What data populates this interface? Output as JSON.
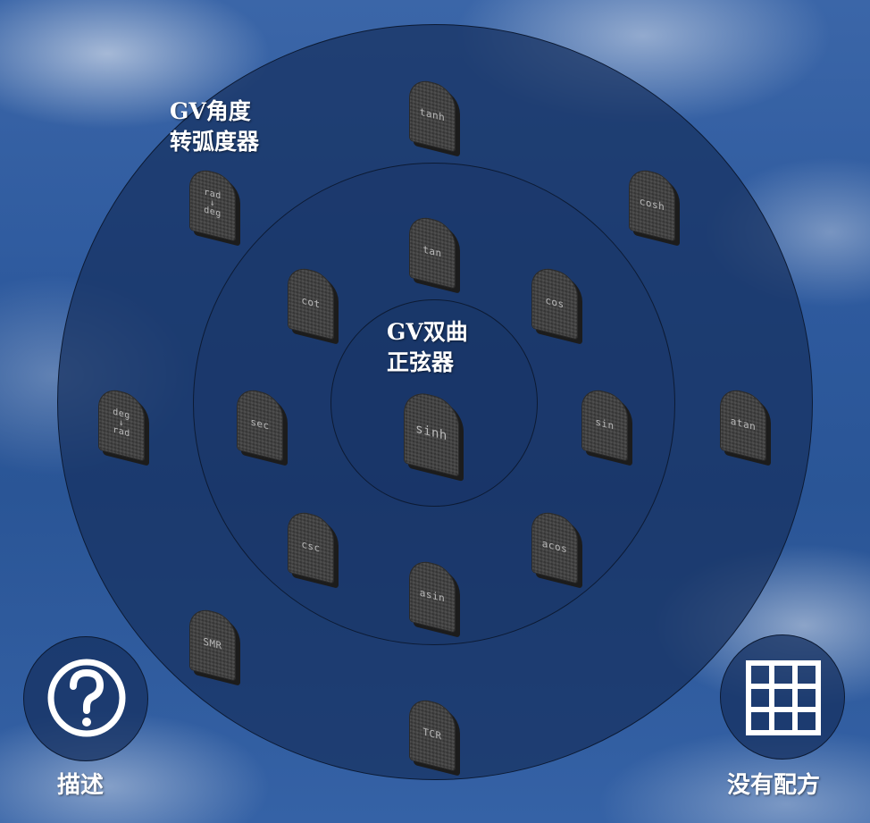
{
  "outer_category_title": "GV角度\n转弧度器",
  "center_title": "GV双曲\n正弦器",
  "center_stone": {
    "label": "sinh"
  },
  "middle_ring_stones": [
    {
      "name": "stone-tan",
      "label": "tan"
    },
    {
      "name": "stone-cos",
      "label": "cos"
    },
    {
      "name": "stone-sin",
      "label": "sin"
    },
    {
      "name": "stone-acos",
      "label": "acos"
    },
    {
      "name": "stone-asin",
      "label": "asin"
    },
    {
      "name": "stone-csc",
      "label": "csc"
    },
    {
      "name": "stone-sec",
      "label": "sec"
    },
    {
      "name": "stone-cot",
      "label": "cot"
    }
  ],
  "outer_ring_stones": [
    {
      "name": "stone-tanh",
      "label": "tanh"
    },
    {
      "name": "stone-cosh",
      "label": "cosh"
    },
    {
      "name": "stone-atan",
      "label": "atan"
    },
    {
      "name": "stone-tcr",
      "label": "TCR"
    },
    {
      "name": "stone-smr",
      "label": "SMR"
    },
    {
      "name": "stone-deg-to-rad",
      "label": "deg\n↓\nrad"
    },
    {
      "name": "stone-rad-to-deg",
      "label": "rad\n↓\ndeg"
    }
  ],
  "help": {
    "icon": "question-mark-icon",
    "label": "描述"
  },
  "recipes": {
    "icon": "grid-icon",
    "label": "没有配方"
  },
  "colors": {
    "sky": "#2e5a9e",
    "ring_fill": "#163060",
    "ring_border": "#0c1a33",
    "stone": "#3e3e3e",
    "stone_text": "#b9b9b9",
    "text": "#ffffff"
  }
}
